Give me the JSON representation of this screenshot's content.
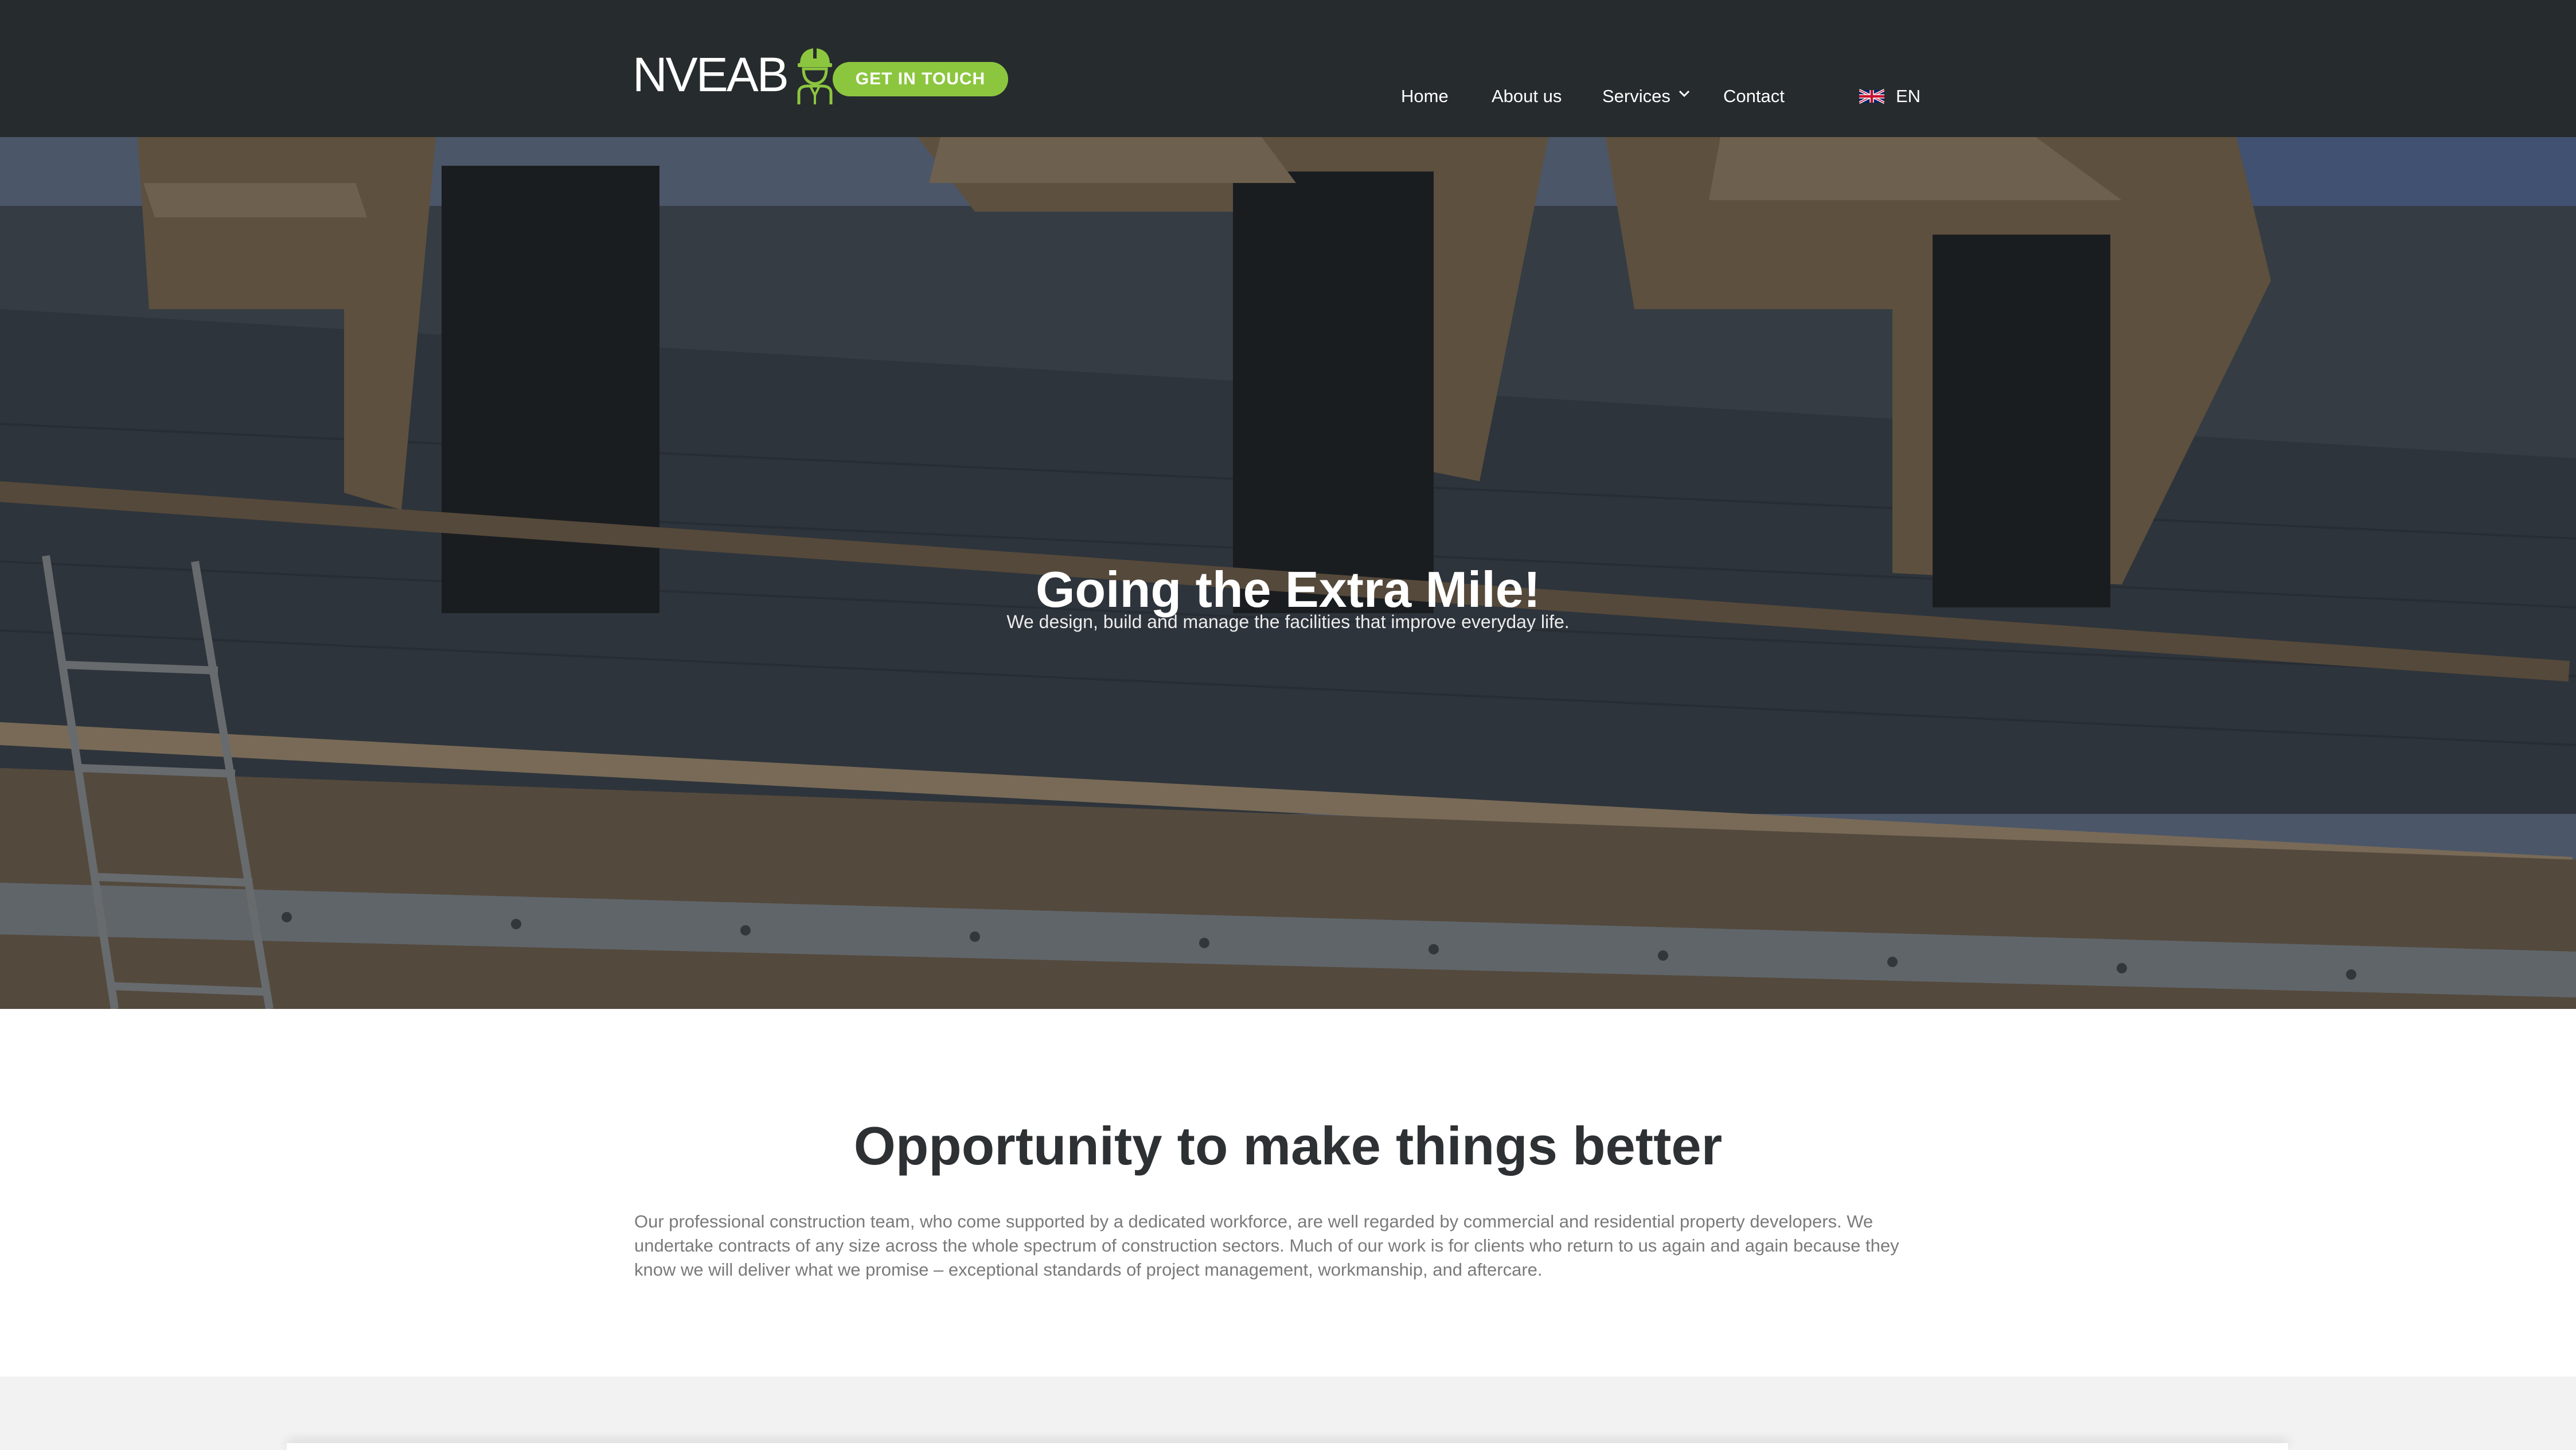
{
  "header": {
    "logo_text": "NVEAB",
    "logo_icon": "builder-hardhat-icon",
    "cta_label": "GET IN TOUCH",
    "nav": {
      "home": "Home",
      "about": "About us",
      "services": "Services",
      "contact": "Contact"
    },
    "language": {
      "flag_icon": "uk-flag-icon",
      "label": "EN"
    }
  },
  "hero": {
    "title": "Going the Extra Mile!",
    "subtitle": "We design, build and manage the facilities that improve everyday life."
  },
  "intro": {
    "title": "Opportunity to make things better",
    "body": "Our professional construction team, who come supported by a dedicated workforce, are well regarded by commercial and residential property developers. We undertake contracts of any size across the whole spectrum of construction sectors. Much of our work is for clients who return to us again and again because they know we will deliver what we promise –  exceptional standards of project management, workmanship, and aftercare."
  },
  "colors": {
    "header_bg": "#262b2d",
    "accent_green": "#8cc63f",
    "heading_text": "#2e3133",
    "body_text": "#7a7a7a",
    "band_bg": "#f2f2f2"
  }
}
